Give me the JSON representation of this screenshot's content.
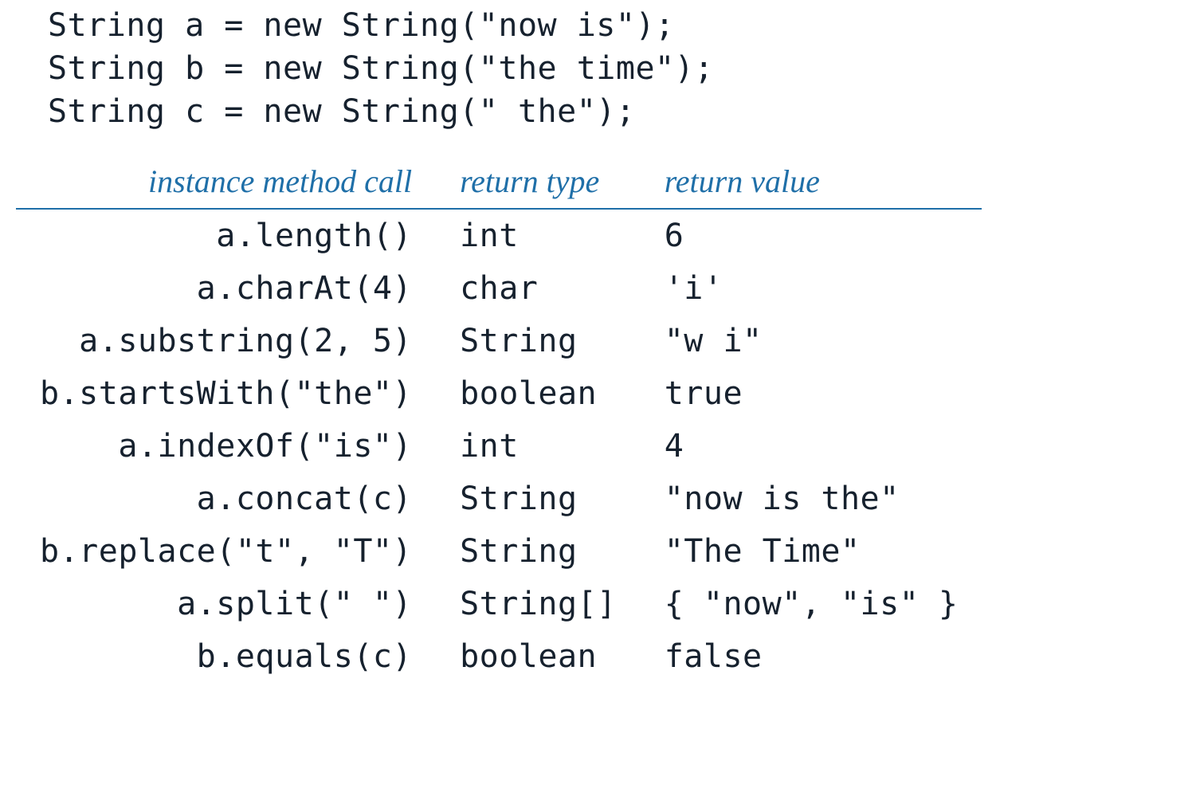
{
  "code": {
    "lines": [
      "String a = new String(\"now is\");",
      "String b = new String(\"the time\");",
      "String c = new String(\" the\");"
    ]
  },
  "table": {
    "headers": {
      "call": "instance method call",
      "type": "return type",
      "value": "return value"
    },
    "rows": [
      {
        "call": "a.length()",
        "type": "int",
        "value": "6"
      },
      {
        "call": "a.charAt(4)",
        "type": "char",
        "value": "'i'"
      },
      {
        "call": "a.substring(2, 5)",
        "type": "String",
        "value": "\"w i\""
      },
      {
        "call": "b.startsWith(\"the\")",
        "type": "boolean",
        "value": "true"
      },
      {
        "call": "a.indexOf(\"is\")",
        "type": "int",
        "value": "4"
      },
      {
        "call": "a.concat(c)",
        "type": "String",
        "value": "\"now is the\""
      },
      {
        "call": "b.replace(\"t\", \"T\")",
        "type": "String",
        "value": "\"The Time\""
      },
      {
        "call": "a.split(\" \")",
        "type": "String[]",
        "value": "{ \"now\", \"is\" }"
      },
      {
        "call": "b.equals(c)",
        "type": "boolean",
        "value": "false"
      }
    ]
  }
}
